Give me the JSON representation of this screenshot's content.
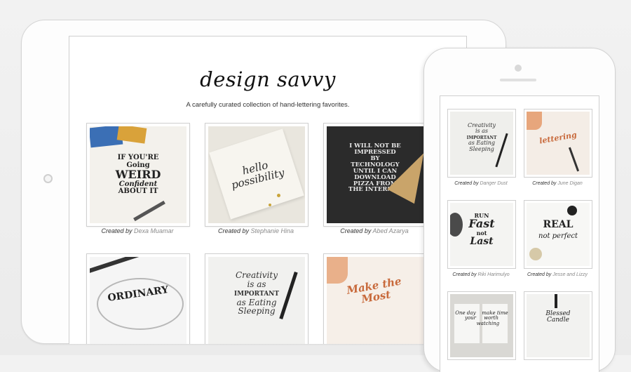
{
  "site": {
    "title": "design savvy",
    "tagline": "A carefully curated collection of hand-lettering favorites."
  },
  "created_by_label": "Created by",
  "tablet_tiles": [
    {
      "author": "Dexa Muamar",
      "art_text": "IF YOU'RE GOING TO BE WEIRD BE CONFIDENT ABOUT IT",
      "theme": "white"
    },
    {
      "author": "Stephanie Hina",
      "art_text": "hello possibility",
      "theme": "cream"
    },
    {
      "author": "Abed Azarya",
      "art_text": "I WILL NOT BE IMPRESSED BY TECHNOLOGY UNTIL I CAN DOWNLOAD PIZZA FROM THE INTERNET",
      "theme": "dark"
    },
    {
      "author": "",
      "art_text": "ORDINARY",
      "theme": "white"
    },
    {
      "author": "",
      "art_text": "Creativity is as IMPORTANT as Eating & Sleeping",
      "theme": "white"
    },
    {
      "author": "",
      "art_text": "Make the Most",
      "theme": "peach"
    }
  ],
  "phone_tiles": [
    {
      "author": "Danger Dust",
      "art_text": "Creativity is as IMPORTANT as Eating & Sleeping",
      "theme": "white"
    },
    {
      "author": "June Digan",
      "art_text": "lettering",
      "theme": "peach"
    },
    {
      "author": "Riki Harimulyo",
      "art_text": "RUN Fast not LAST",
      "theme": "white"
    },
    {
      "author": "Jesse and Lizzy",
      "art_text": "REAL not perfect",
      "theme": "white"
    },
    {
      "author": "",
      "art_text": "One day make time worth watching",
      "theme": "book"
    },
    {
      "author": "",
      "art_text": "Blessed Candle",
      "theme": "white"
    }
  ],
  "colors": {
    "device_frame": "#fdfdfd",
    "device_border": "#d6d6d6",
    "author_text": "#8a8a8a",
    "caption_text": "#333333",
    "background": "#eeeeee"
  },
  "icons": {
    "tablet_home": "home-button-icon",
    "phone_camera": "camera-icon",
    "phone_speaker": "speaker-icon"
  }
}
